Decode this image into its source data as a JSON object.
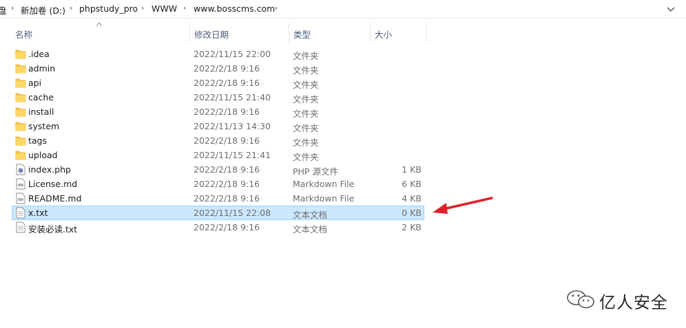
{
  "breadcrumb": {
    "items": [
      "盘",
      "新加卷 (D:)",
      "phpstudy_pro",
      "WWW",
      "www.bosscms.com"
    ]
  },
  "columns": {
    "name": "名称",
    "date": "修改日期",
    "type": "类型",
    "size": "大小"
  },
  "files": [
    {
      "name": ".idea",
      "date": "2022/11/15 22:00",
      "type": "文件夹",
      "size": "",
      "icon": "folder-icon"
    },
    {
      "name": "admin",
      "date": "2022/2/18 9:16",
      "type": "文件夹",
      "size": "",
      "icon": "folder-icon"
    },
    {
      "name": "api",
      "date": "2022/2/18 9:16",
      "type": "文件夹",
      "size": "",
      "icon": "folder-icon"
    },
    {
      "name": "cache",
      "date": "2022/11/15 21:40",
      "type": "文件夹",
      "size": "",
      "icon": "folder-icon"
    },
    {
      "name": "install",
      "date": "2022/2/18 9:16",
      "type": "文件夹",
      "size": "",
      "icon": "folder-icon"
    },
    {
      "name": "system",
      "date": "2022/11/13 14:30",
      "type": "文件夹",
      "size": "",
      "icon": "folder-icon"
    },
    {
      "name": "tags",
      "date": "2022/2/18 9:16",
      "type": "文件夹",
      "size": "",
      "icon": "folder-icon"
    },
    {
      "name": "upload",
      "date": "2022/11/15 21:41",
      "type": "文件夹",
      "size": "",
      "icon": "folder-icon"
    },
    {
      "name": "index.php",
      "date": "2022/2/18 9:16",
      "type": "PHP 源文件",
      "size": "1 KB",
      "icon": "php-file-icon"
    },
    {
      "name": "License.md",
      "date": "2022/2/18 9:16",
      "type": "Markdown File",
      "size": "6 KB",
      "icon": "markdown-file-icon"
    },
    {
      "name": "README.md",
      "date": "2022/2/18 9:16",
      "type": "Markdown File",
      "size": "4 KB",
      "icon": "markdown-file-icon"
    },
    {
      "name": "x.txt",
      "date": "2022/11/15 22:08",
      "type": "文本文档",
      "size": "0 KB",
      "icon": "text-file-icon",
      "selected": true
    },
    {
      "name": "安装必读.txt",
      "date": "2022/2/18 9:16",
      "type": "文本文档",
      "size": "2 KB",
      "icon": "text-file-icon"
    }
  ],
  "annotation": {
    "arrow_color": "#e0202a"
  },
  "watermark": {
    "text": "亿人安全"
  }
}
